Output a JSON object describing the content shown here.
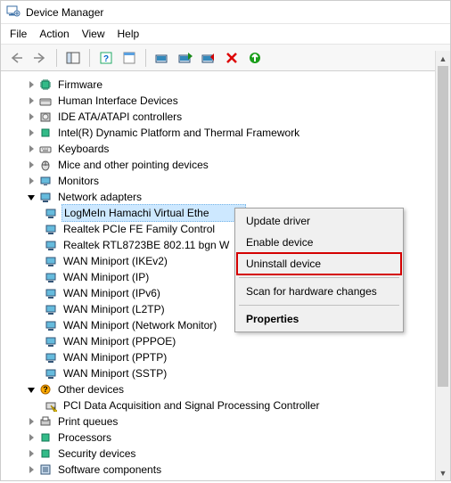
{
  "window": {
    "title": "Device Manager"
  },
  "menu": {
    "file": "File",
    "action": "Action",
    "view": "View",
    "help": "Help"
  },
  "tree": {
    "firmware": "Firmware",
    "hid": "Human Interface Devices",
    "ide": "IDE ATA/ATAPI controllers",
    "intel": "Intel(R) Dynamic Platform and Thermal Framework",
    "keyboards": "Keyboards",
    "mice": "Mice and other pointing devices",
    "monitors": "Monitors",
    "network": "Network adapters",
    "net": {
      "hamachi": "LogMeIn Hamachi Virtual Ethe",
      "realtek_fe": "Realtek PCIe FE Family Control",
      "realtek_wifi": "Realtek RTL8723BE 802.11 bgn W",
      "wan_ikev2": "WAN Miniport (IKEv2)",
      "wan_ip": "WAN Miniport (IP)",
      "wan_ipv6": "WAN Miniport (IPv6)",
      "wan_l2tp": "WAN Miniport (L2TP)",
      "wan_netmon": "WAN Miniport (Network Monitor)",
      "wan_pppoe": "WAN Miniport (PPPOE)",
      "wan_pptp": "WAN Miniport (PPTP)",
      "wan_sstp": "WAN Miniport (SSTP)"
    },
    "other": "Other devices",
    "pci_daq": "PCI Data Acquisition and Signal Processing Controller",
    "print_queues": "Print queues",
    "processors": "Processors",
    "security": "Security devices",
    "software": "Software components"
  },
  "context_menu": {
    "update": "Update driver",
    "enable": "Enable device",
    "uninstall": "Uninstall device",
    "scan": "Scan for hardware changes",
    "properties": "Properties"
  }
}
